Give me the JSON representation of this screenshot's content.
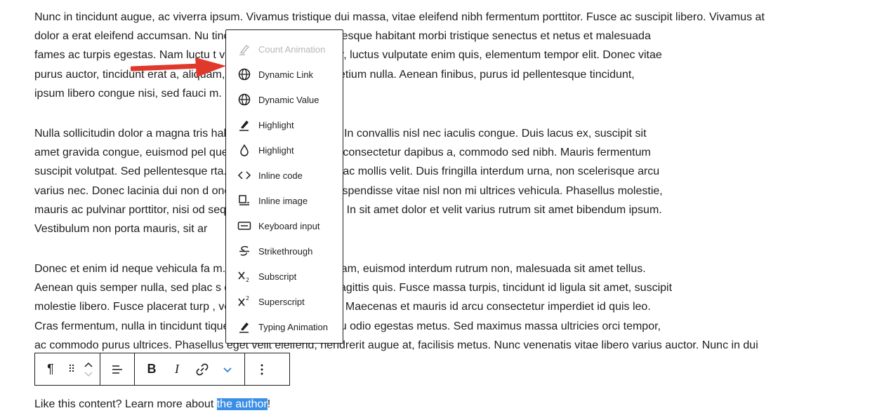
{
  "paragraphs": [
    {
      "lines": [
        "Nunc in tincidunt augue, ac viverra ipsum. Vivamus tristique dui massa, vitae eleifend nibh fermentum porttitor. Fusce ac suscipit libero. Vivamus at",
        "dolor a erat eleifend accumsan. Nu                                        tincidunt hendrerit. Pellentesque habitant morbi tristique senectus et netus et malesuada",
        "fames ac turpis egestas. Nam luctu                                        t volutpat. Sed lorem dolor, luctus vulputate enim quis, elementum tempor elit. Donec vitae",
        "purus auctor, tincidunt erat a,                                            aliquam, euismod magna ac, pretium nulla. Aenean finibus, purus id pellentesque tincidunt,",
        "ipsum libero congue nisi, sed fauci                                        m."
      ]
    },
    {
      "lines": [
        "Nulla sollicitudin dolor a magna tris                                       habitasse platea dictumst. In convallis nisl nec iaculis congue. Duis lacus ex, suscipit sit",
        "amet gravida congue, euismod pel                                          que neque risus, hendrerit consectetur dapibus a, commodo sed nibh. Mauris fermentum",
        "suscipit volutpat. Sed pellentesque                                        rta. Nam eget tempor nisl, ac mollis velit. Duis fringilla interdum urna, non scelerisque arcu",
        "varius nec. Donec lacinia dui non d                                        oncus dolor bibendum. Suspendisse vitae nisl non mi ultrices vehicula. Phasellus molestie,",
        "mauris ac pulvinar porttitor, nisi od                                        sequat orci erat feugiat est. In sit amet dolor et velit varius rutrum sit amet bibendum ipsum.",
        "Vestibulum non porta mauris, sit ar"
      ]
    },
    {
      "lines": [
        "Donec et enim id neque vehicula fa                                         m. Suspendisse lectus quam, euismod interdum rutrum non, malesuada sit amet tellus.",
        "Aenean quis semper nulla, sed plac                                         s dui dolor, a feugiat ex sagittis quis. Fusce massa turpis, tincidunt id ligula sit amet, suscipit",
        "molestie libero. Fusce placerat turp                                       , vel tincidunt arcu blandit. Maecenas et mauris id arcu consectetur imperdiet id quis leo.",
        "Cras fermentum, nulla in tincidunt                                          tique augue, ut aliquam arcu odio egestas metus. Sed maximus massa ultricies orci tempor,",
        "ac commodo purus ultrices. Phasellus eget velit eleifend, hendrerit augue at, facilisis metus. Nunc venenatis vitae libero varius auctor. Nunc in dui"
      ]
    }
  ],
  "cta": {
    "prefix": "Like this content? Learn more about ",
    "highlighted": "the author",
    "suffix": "!"
  },
  "menu": {
    "items": [
      {
        "label": "Count Animation",
        "icon": "pen-icon",
        "disabled": true
      },
      {
        "label": "Dynamic Link",
        "icon": "globe-icon"
      },
      {
        "label": "Dynamic Value",
        "icon": "globe-icon"
      },
      {
        "label": "Highlight",
        "icon": "pen-icon"
      },
      {
        "label": "Highlight",
        "icon": "drop-icon"
      },
      {
        "label": "Inline code",
        "icon": "code-icon"
      },
      {
        "label": "Inline image",
        "icon": "image-icon"
      },
      {
        "label": "Keyboard input",
        "icon": "keyboard-icon"
      },
      {
        "label": "Strikethrough",
        "icon": "strikethrough-icon"
      },
      {
        "label": "Subscript",
        "icon": "subscript-icon"
      },
      {
        "label": "Superscript",
        "icon": "superscript-icon"
      },
      {
        "label": "Typing Animation",
        "icon": "pen-icon"
      }
    ]
  },
  "toolbar": {
    "paragraph_glyph": "¶",
    "drag_glyph": "⠿",
    "bold_glyph": "B",
    "italic_glyph": "I"
  },
  "colors": {
    "selection": "#3a8ee6",
    "arrow": "#e0392b",
    "text": "#1e1e1e",
    "disabled": "#b8b8b8"
  }
}
